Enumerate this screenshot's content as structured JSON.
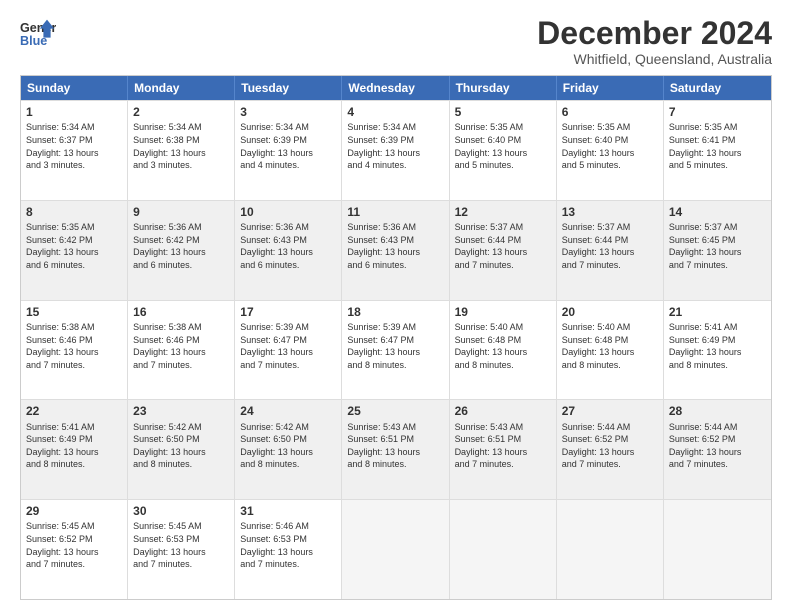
{
  "logo": {
    "line1": "General",
    "line2": "Blue"
  },
  "header": {
    "month": "December 2024",
    "location": "Whitfield, Queensland, Australia"
  },
  "weekdays": [
    "Sunday",
    "Monday",
    "Tuesday",
    "Wednesday",
    "Thursday",
    "Friday",
    "Saturday"
  ],
  "rows": [
    [
      {
        "day": "1",
        "lines": [
          "Sunrise: 5:34 AM",
          "Sunset: 6:37 PM",
          "Daylight: 13 hours",
          "and 3 minutes."
        ]
      },
      {
        "day": "2",
        "lines": [
          "Sunrise: 5:34 AM",
          "Sunset: 6:38 PM",
          "Daylight: 13 hours",
          "and 3 minutes."
        ]
      },
      {
        "day": "3",
        "lines": [
          "Sunrise: 5:34 AM",
          "Sunset: 6:39 PM",
          "Daylight: 13 hours",
          "and 4 minutes."
        ]
      },
      {
        "day": "4",
        "lines": [
          "Sunrise: 5:34 AM",
          "Sunset: 6:39 PM",
          "Daylight: 13 hours",
          "and 4 minutes."
        ]
      },
      {
        "day": "5",
        "lines": [
          "Sunrise: 5:35 AM",
          "Sunset: 6:40 PM",
          "Daylight: 13 hours",
          "and 5 minutes."
        ]
      },
      {
        "day": "6",
        "lines": [
          "Sunrise: 5:35 AM",
          "Sunset: 6:40 PM",
          "Daylight: 13 hours",
          "and 5 minutes."
        ]
      },
      {
        "day": "7",
        "lines": [
          "Sunrise: 5:35 AM",
          "Sunset: 6:41 PM",
          "Daylight: 13 hours",
          "and 5 minutes."
        ]
      }
    ],
    [
      {
        "day": "8",
        "lines": [
          "Sunrise: 5:35 AM",
          "Sunset: 6:42 PM",
          "Daylight: 13 hours",
          "and 6 minutes."
        ]
      },
      {
        "day": "9",
        "lines": [
          "Sunrise: 5:36 AM",
          "Sunset: 6:42 PM",
          "Daylight: 13 hours",
          "and 6 minutes."
        ]
      },
      {
        "day": "10",
        "lines": [
          "Sunrise: 5:36 AM",
          "Sunset: 6:43 PM",
          "Daylight: 13 hours",
          "and 6 minutes."
        ]
      },
      {
        "day": "11",
        "lines": [
          "Sunrise: 5:36 AM",
          "Sunset: 6:43 PM",
          "Daylight: 13 hours",
          "and 6 minutes."
        ]
      },
      {
        "day": "12",
        "lines": [
          "Sunrise: 5:37 AM",
          "Sunset: 6:44 PM",
          "Daylight: 13 hours",
          "and 7 minutes."
        ]
      },
      {
        "day": "13",
        "lines": [
          "Sunrise: 5:37 AM",
          "Sunset: 6:44 PM",
          "Daylight: 13 hours",
          "and 7 minutes."
        ]
      },
      {
        "day": "14",
        "lines": [
          "Sunrise: 5:37 AM",
          "Sunset: 6:45 PM",
          "Daylight: 13 hours",
          "and 7 minutes."
        ]
      }
    ],
    [
      {
        "day": "15",
        "lines": [
          "Sunrise: 5:38 AM",
          "Sunset: 6:46 PM",
          "Daylight: 13 hours",
          "and 7 minutes."
        ]
      },
      {
        "day": "16",
        "lines": [
          "Sunrise: 5:38 AM",
          "Sunset: 6:46 PM",
          "Daylight: 13 hours",
          "and 7 minutes."
        ]
      },
      {
        "day": "17",
        "lines": [
          "Sunrise: 5:39 AM",
          "Sunset: 6:47 PM",
          "Daylight: 13 hours",
          "and 7 minutes."
        ]
      },
      {
        "day": "18",
        "lines": [
          "Sunrise: 5:39 AM",
          "Sunset: 6:47 PM",
          "Daylight: 13 hours",
          "and 8 minutes."
        ]
      },
      {
        "day": "19",
        "lines": [
          "Sunrise: 5:40 AM",
          "Sunset: 6:48 PM",
          "Daylight: 13 hours",
          "and 8 minutes."
        ]
      },
      {
        "day": "20",
        "lines": [
          "Sunrise: 5:40 AM",
          "Sunset: 6:48 PM",
          "Daylight: 13 hours",
          "and 8 minutes."
        ]
      },
      {
        "day": "21",
        "lines": [
          "Sunrise: 5:41 AM",
          "Sunset: 6:49 PM",
          "Daylight: 13 hours",
          "and 8 minutes."
        ]
      }
    ],
    [
      {
        "day": "22",
        "lines": [
          "Sunrise: 5:41 AM",
          "Sunset: 6:49 PM",
          "Daylight: 13 hours",
          "and 8 minutes."
        ]
      },
      {
        "day": "23",
        "lines": [
          "Sunrise: 5:42 AM",
          "Sunset: 6:50 PM",
          "Daylight: 13 hours",
          "and 8 minutes."
        ]
      },
      {
        "day": "24",
        "lines": [
          "Sunrise: 5:42 AM",
          "Sunset: 6:50 PM",
          "Daylight: 13 hours",
          "and 8 minutes."
        ]
      },
      {
        "day": "25",
        "lines": [
          "Sunrise: 5:43 AM",
          "Sunset: 6:51 PM",
          "Daylight: 13 hours",
          "and 8 minutes."
        ]
      },
      {
        "day": "26",
        "lines": [
          "Sunrise: 5:43 AM",
          "Sunset: 6:51 PM",
          "Daylight: 13 hours",
          "and 7 minutes."
        ]
      },
      {
        "day": "27",
        "lines": [
          "Sunrise: 5:44 AM",
          "Sunset: 6:52 PM",
          "Daylight: 13 hours",
          "and 7 minutes."
        ]
      },
      {
        "day": "28",
        "lines": [
          "Sunrise: 5:44 AM",
          "Sunset: 6:52 PM",
          "Daylight: 13 hours",
          "and 7 minutes."
        ]
      }
    ],
    [
      {
        "day": "29",
        "lines": [
          "Sunrise: 5:45 AM",
          "Sunset: 6:52 PM",
          "Daylight: 13 hours",
          "and 7 minutes."
        ]
      },
      {
        "day": "30",
        "lines": [
          "Sunrise: 5:45 AM",
          "Sunset: 6:53 PM",
          "Daylight: 13 hours",
          "and 7 minutes."
        ]
      },
      {
        "day": "31",
        "lines": [
          "Sunrise: 5:46 AM",
          "Sunset: 6:53 PM",
          "Daylight: 13 hours",
          "and 7 minutes."
        ]
      },
      {
        "day": "",
        "lines": []
      },
      {
        "day": "",
        "lines": []
      },
      {
        "day": "",
        "lines": []
      },
      {
        "day": "",
        "lines": []
      }
    ]
  ]
}
